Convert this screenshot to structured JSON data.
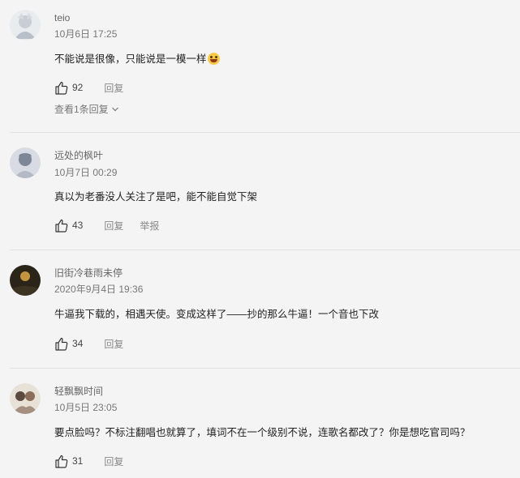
{
  "comments": [
    {
      "user": "teio",
      "time": "10月6日 17:25",
      "text": "不能说是很像，只能说是一模一样",
      "emoji": "grinning-sweat-emoji",
      "likes": "92",
      "reply_label": "回复",
      "view_replies": "查看1条回复"
    },
    {
      "user": "远处的枫叶",
      "time": "10月7日 00:29",
      "text": "真以为老番没人关注了是吧，能不能自觉下架",
      "likes": "43",
      "reply_label": "回复",
      "report_label": "举报"
    },
    {
      "user": "旧街冷巷雨未停",
      "time": "2020年9月4日 19:36",
      "text": "牛逼我下载的，相遇天使。变成这样了——抄的那么牛逼！一个音也下改",
      "likes": "34",
      "reply_label": "回复"
    },
    {
      "user": "轻飘飘时间",
      "time": "10月5日 23:05",
      "text": "要点脸吗？不标注翻唱也就算了，填词不在一个级别不说，连歌名都改了？你是想吃官司吗？",
      "likes": "31",
      "reply_label": "回复"
    }
  ],
  "icons": {
    "like": "thumbs-up-icon",
    "expand": "chevron-down-icon"
  }
}
